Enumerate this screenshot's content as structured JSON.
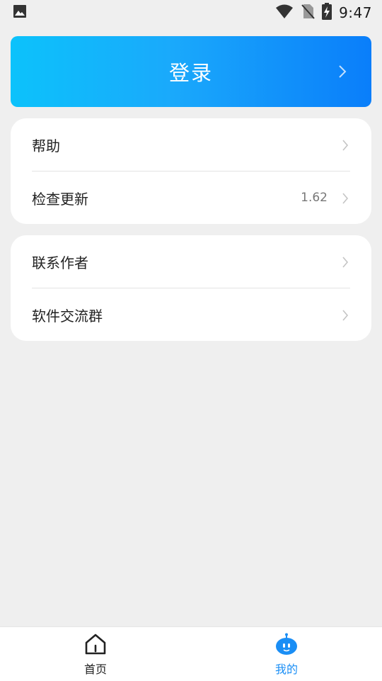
{
  "status_bar": {
    "time": "9:47",
    "icons": [
      "image-icon",
      "wifi-icon",
      "no-sim-icon",
      "battery-charging-icon"
    ]
  },
  "login": {
    "label": "登录"
  },
  "group1": {
    "items": [
      {
        "label": "帮助",
        "value": ""
      },
      {
        "label": "检查更新",
        "value": "1.62"
      }
    ]
  },
  "group2": {
    "items": [
      {
        "label": "联系作者",
        "value": ""
      },
      {
        "label": "软件交流群",
        "value": ""
      }
    ]
  },
  "bottom_nav": {
    "items": [
      {
        "label": "首页",
        "icon": "home-icon",
        "active": false
      },
      {
        "label": "我的",
        "icon": "robot-face-icon",
        "active": true
      }
    ],
    "active_color": "#1a8ef5"
  },
  "colors": {
    "background": "#efefef",
    "login_gradient_start": "#0cc2fb",
    "login_gradient_end": "#0a7efa"
  }
}
